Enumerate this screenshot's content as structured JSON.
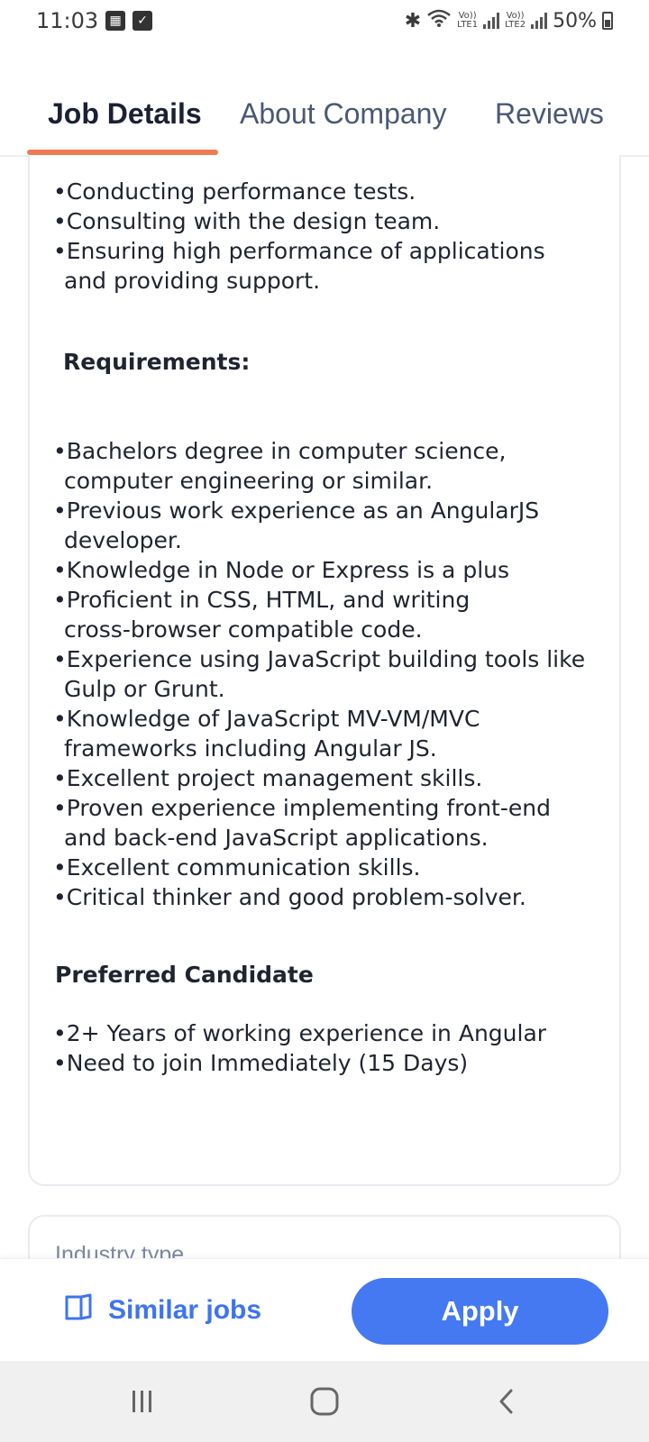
{
  "status_bar": {
    "time": "11:03",
    "battery_text": "50%",
    "lte1": "LTE1",
    "lte2": "LTE2",
    "volte": "Vo))"
  },
  "tabs": [
    {
      "label": "Job Details",
      "active": true
    },
    {
      "label": "About Company",
      "active": false
    },
    {
      "label": "Reviews",
      "active": false
    }
  ],
  "description": {
    "responsibilities": [
      [
        "•Conducting performance tests."
      ],
      [
        "•Consulting with the design team."
      ],
      [
        "•Ensuring high performance of applications",
        "and providing support."
      ]
    ],
    "requirements_heading": "Requirements:",
    "requirements": [
      [
        "•Bachelors degree in computer science,",
        "computer engineering or similar."
      ],
      [
        "•Previous work experience as an AngularJS",
        "developer."
      ],
      [
        "•Knowledge in Node or Express is a plus"
      ],
      [
        "•Proficient in CSS, HTML, and writing",
        "cross-browser compatible code."
      ],
      [
        "•Experience using JavaScript building tools like",
        "Gulp or Grunt."
      ],
      [
        "•Knowledge of JavaScript MV-VM/MVC",
        "frameworks including Angular JS."
      ],
      [
        "•Excellent project management skills."
      ],
      [
        "•Proven experience implementing front-end",
        "and back-end JavaScript applications."
      ],
      [
        "•Excellent communication skills."
      ],
      [
        "•Critical thinker and good problem-solver."
      ]
    ],
    "preferred_heading": "Preferred Candidate",
    "preferred": [
      [
        "•2+ Years of working experience in Angular"
      ],
      [
        "•Need to join Immediately (15 Days)"
      ]
    ]
  },
  "industry_card": {
    "label": "Industry type"
  },
  "actions": {
    "similar_jobs_label": "Similar jobs",
    "apply_label": "Apply"
  },
  "colors": {
    "accent_tab": "#f07a55",
    "primary": "#4479f2",
    "link": "#3d74f0"
  },
  "icons": {
    "similar_jobs": "book-icon",
    "nav_recents": "recents-icon",
    "nav_home": "home-icon",
    "nav_back": "back-icon"
  }
}
